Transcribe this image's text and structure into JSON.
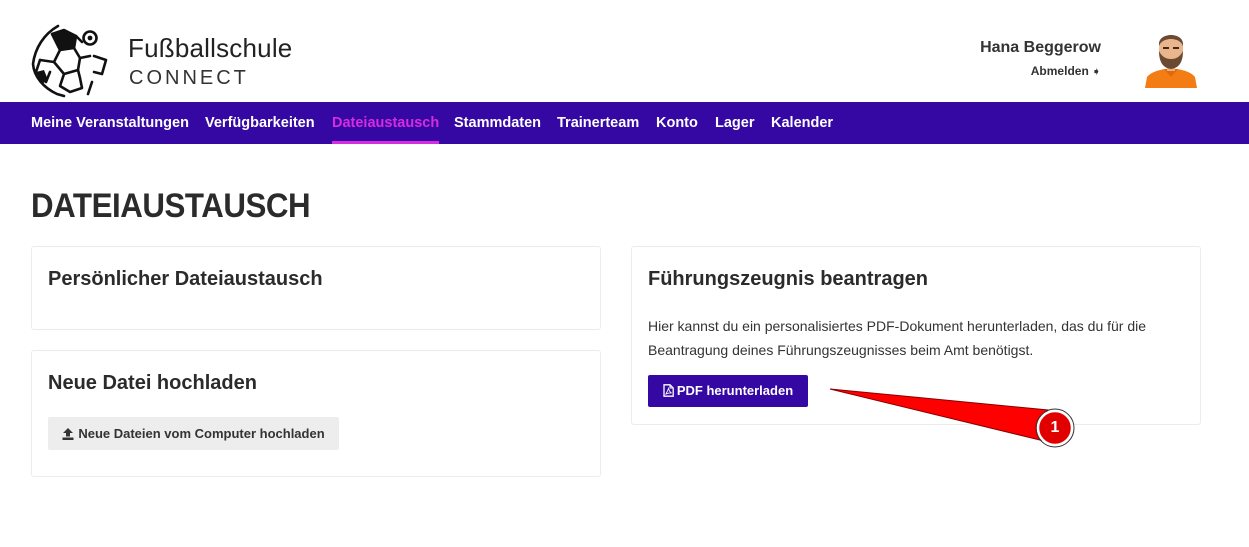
{
  "brand": {
    "line1": "Fußballschule",
    "line2": "CONNECT"
  },
  "user": {
    "name": "Hana Beggerow",
    "logout_label": "Abmelden",
    "logout_icon": "sign-out-icon"
  },
  "nav": {
    "items": [
      {
        "label": "Meine Veranstaltungen"
      },
      {
        "label": "Verfügbarkeiten"
      },
      {
        "label": "Dateiaustausch",
        "active": true
      },
      {
        "label": "Stammdaten"
      },
      {
        "label": "Trainerteam"
      },
      {
        "label": "Konto"
      },
      {
        "label": "Lager"
      },
      {
        "label": "Kalender"
      }
    ]
  },
  "page": {
    "title": "DATEIAUSTAUSCH"
  },
  "cards": {
    "personal": {
      "title": "Persönlicher Dateiaustausch"
    },
    "upload": {
      "title": "Neue Datei hochladen",
      "button_label": "Neue Dateien vom Computer hochladen",
      "button_icon": "upload-icon"
    },
    "fuehrungszeugnis": {
      "title": "Führungszeugnis beantragen",
      "description": "Hier kannst du ein personalisiertes PDF-Dokument herunterladen, das du für die Beantragung deines Führungszeugnisses beim Amt benötigst.",
      "button_label": "PDF herunterladen",
      "button_icon": "pdf-file-icon"
    }
  },
  "annotation": {
    "marker_label": "1"
  },
  "colors": {
    "nav_bg": "#3508a4",
    "nav_active": "#d62ce0",
    "primary_button": "#3508a4",
    "annotation_red": "#ff0000"
  }
}
